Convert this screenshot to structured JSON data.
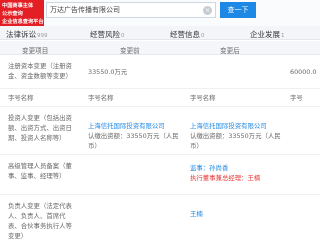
{
  "logo": {
    "line1": "中国商事主体",
    "line2": "公示查询",
    "line3": "企业信息查询平台"
  },
  "search": {
    "value": "万达广告传播有限公司",
    "button": "查一下",
    "clear": "×"
  },
  "tabs": [
    {
      "label": "法律诉讼",
      "count": "999"
    },
    {
      "label": "经营风险",
      "count": "0"
    },
    {
      "label": "经营信息",
      "count": "0"
    },
    {
      "label": "企业发展",
      "count": "1"
    }
  ],
  "table": {
    "headers": {
      "item": "变更项目",
      "change": "变更前",
      "after": "变更后"
    },
    "rows": [
      {
        "item": "注册资本变更（注册资金、资金数额等变更）",
        "before": "33550.0万元",
        "after": "",
        "far": "60000.0"
      },
      {
        "item": "字号名称",
        "before": "字号名称",
        "after": "字号名称",
        "far": "字号"
      },
      {
        "item": "投资人变更（包括出资额、出资方式、出资日期、投资人名称等）",
        "before": "上海信托国际投资有限公司",
        "before2": "认缴出资额：33550万元（人民币）",
        "after": "上海信托国际投资有限公司",
        "after2": "认缴出资额：33550万元（人民币）",
        "far": ""
      },
      {
        "item": "高级管理人员备案（董事、监事、经理等）",
        "before": "",
        "after": "监事：孙尚香",
        "after2": "执行董事兼总经理：王楠",
        "far": ""
      },
      {
        "item": "负责人变更（法定代表人、负责人、首席代表、合伙事务执行人等变更）",
        "before": "",
        "after": "王楠",
        "far": ""
      }
    ]
  },
  "colors": {
    "brand": "#e31e24",
    "accent": "#1e88e5",
    "alert": "#e53935"
  }
}
